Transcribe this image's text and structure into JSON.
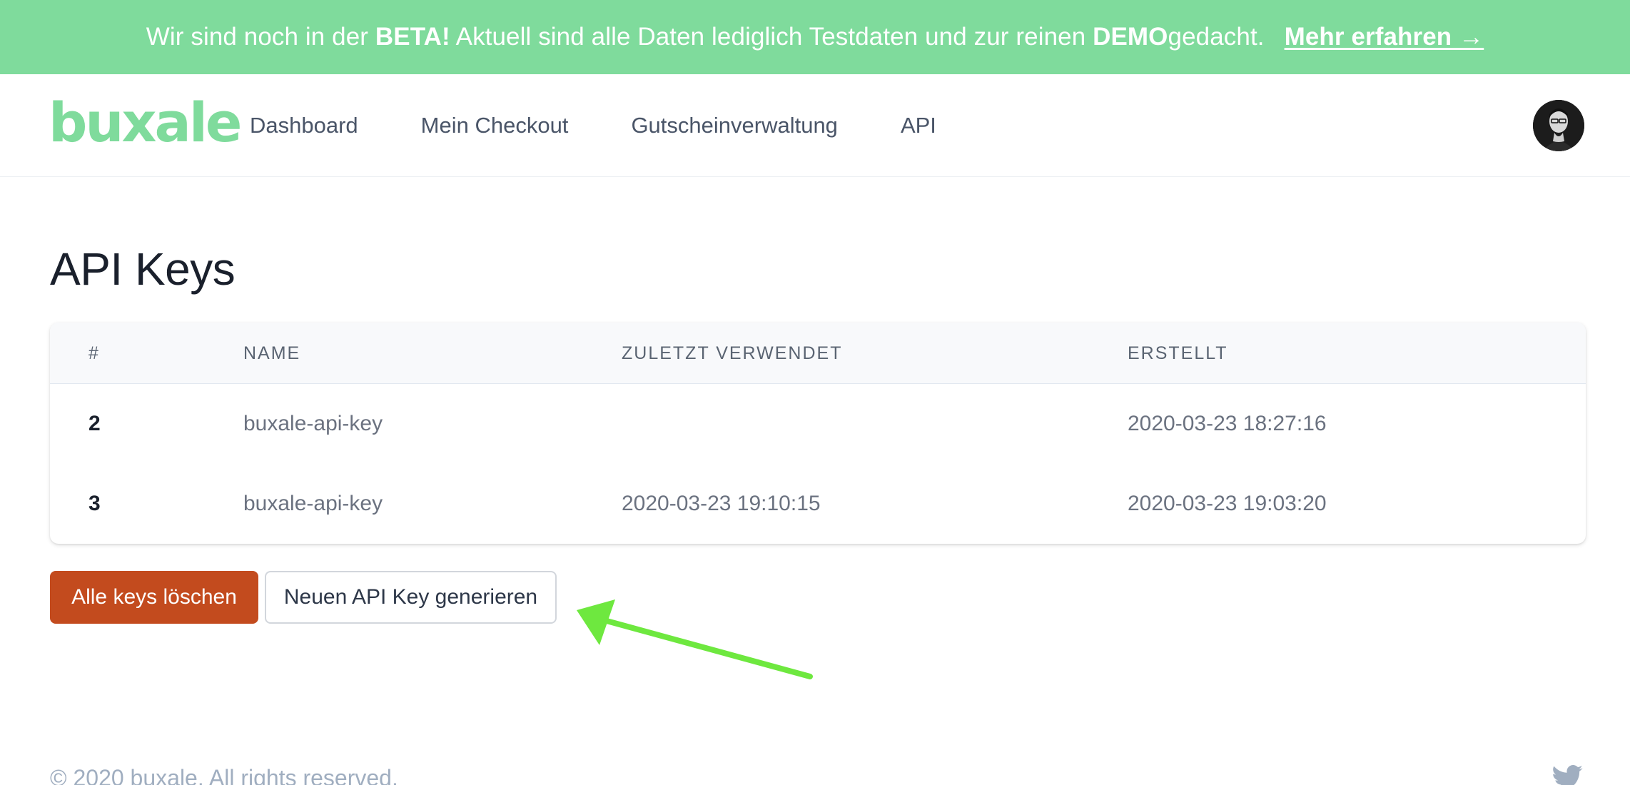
{
  "banner": {
    "text_1": "Wir sind noch in der ",
    "bold_1": "BETA!",
    "text_2": " Aktuell sind alle Daten lediglich Testdaten und zur reinen ",
    "bold_2": "DEMO",
    "text_3": " gedacht.",
    "link_label": "Mehr erfahren →",
    "background_color": "#7fdb9c"
  },
  "header": {
    "logo_text": "buxale",
    "nav": [
      {
        "label": "Dashboard"
      },
      {
        "label": "Mein Checkout"
      },
      {
        "label": "Gutscheinverwaltung"
      },
      {
        "label": "API"
      }
    ],
    "avatar_icon": "user-avatar"
  },
  "main": {
    "title": "API Keys",
    "table": {
      "columns": [
        "#",
        "NAME",
        "ZULETZT VERWENDET",
        "ERSTELLT"
      ],
      "rows": [
        {
          "id": "2",
          "name": "buxale-api-key",
          "last_used": "",
          "created": "2020-03-23 18:27:16"
        },
        {
          "id": "3",
          "name": "buxale-api-key",
          "last_used": "2020-03-23 19:10:15",
          "created": "2020-03-23 19:03:20"
        }
      ]
    },
    "buttons": {
      "delete_all_label": "Alle keys löschen",
      "generate_label": "Neuen API Key generieren"
    },
    "annotation_arrow_color": "#6ee83f"
  },
  "footer": {
    "copyright": "© 2020 buxale. All rights reserved.",
    "social_icon": "twitter-icon"
  }
}
